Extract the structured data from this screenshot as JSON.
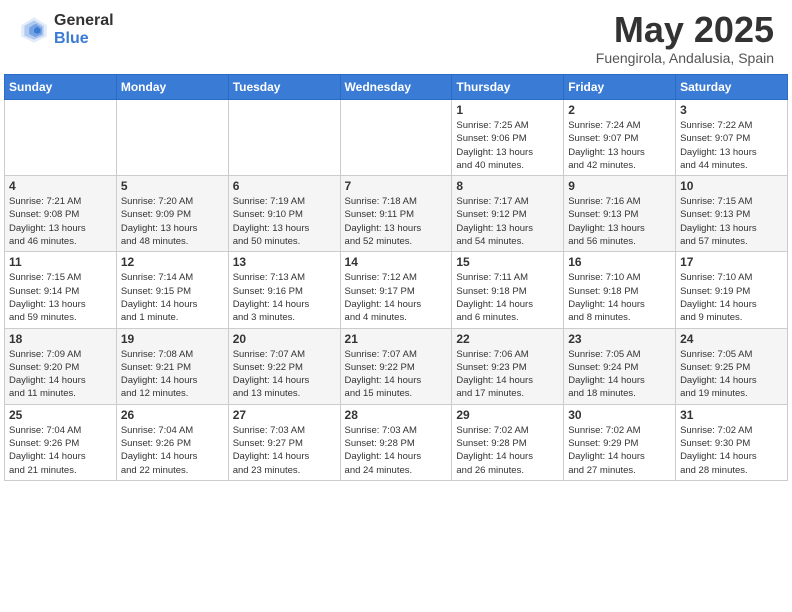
{
  "logo": {
    "general": "General",
    "blue": "Blue"
  },
  "title": "May 2025",
  "location": "Fuengirola, Andalusia, Spain",
  "days_of_week": [
    "Sunday",
    "Monday",
    "Tuesday",
    "Wednesday",
    "Thursday",
    "Friday",
    "Saturday"
  ],
  "weeks": [
    [
      {
        "day": "",
        "info": ""
      },
      {
        "day": "",
        "info": ""
      },
      {
        "day": "",
        "info": ""
      },
      {
        "day": "",
        "info": ""
      },
      {
        "day": "1",
        "info": "Sunrise: 7:25 AM\nSunset: 9:06 PM\nDaylight: 13 hours\nand 40 minutes."
      },
      {
        "day": "2",
        "info": "Sunrise: 7:24 AM\nSunset: 9:07 PM\nDaylight: 13 hours\nand 42 minutes."
      },
      {
        "day": "3",
        "info": "Sunrise: 7:22 AM\nSunset: 9:07 PM\nDaylight: 13 hours\nand 44 minutes."
      }
    ],
    [
      {
        "day": "4",
        "info": "Sunrise: 7:21 AM\nSunset: 9:08 PM\nDaylight: 13 hours\nand 46 minutes."
      },
      {
        "day": "5",
        "info": "Sunrise: 7:20 AM\nSunset: 9:09 PM\nDaylight: 13 hours\nand 48 minutes."
      },
      {
        "day": "6",
        "info": "Sunrise: 7:19 AM\nSunset: 9:10 PM\nDaylight: 13 hours\nand 50 minutes."
      },
      {
        "day": "7",
        "info": "Sunrise: 7:18 AM\nSunset: 9:11 PM\nDaylight: 13 hours\nand 52 minutes."
      },
      {
        "day": "8",
        "info": "Sunrise: 7:17 AM\nSunset: 9:12 PM\nDaylight: 13 hours\nand 54 minutes."
      },
      {
        "day": "9",
        "info": "Sunrise: 7:16 AM\nSunset: 9:13 PM\nDaylight: 13 hours\nand 56 minutes."
      },
      {
        "day": "10",
        "info": "Sunrise: 7:15 AM\nSunset: 9:13 PM\nDaylight: 13 hours\nand 57 minutes."
      }
    ],
    [
      {
        "day": "11",
        "info": "Sunrise: 7:15 AM\nSunset: 9:14 PM\nDaylight: 13 hours\nand 59 minutes."
      },
      {
        "day": "12",
        "info": "Sunrise: 7:14 AM\nSunset: 9:15 PM\nDaylight: 14 hours\nand 1 minute."
      },
      {
        "day": "13",
        "info": "Sunrise: 7:13 AM\nSunset: 9:16 PM\nDaylight: 14 hours\nand 3 minutes."
      },
      {
        "day": "14",
        "info": "Sunrise: 7:12 AM\nSunset: 9:17 PM\nDaylight: 14 hours\nand 4 minutes."
      },
      {
        "day": "15",
        "info": "Sunrise: 7:11 AM\nSunset: 9:18 PM\nDaylight: 14 hours\nand 6 minutes."
      },
      {
        "day": "16",
        "info": "Sunrise: 7:10 AM\nSunset: 9:18 PM\nDaylight: 14 hours\nand 8 minutes."
      },
      {
        "day": "17",
        "info": "Sunrise: 7:10 AM\nSunset: 9:19 PM\nDaylight: 14 hours\nand 9 minutes."
      }
    ],
    [
      {
        "day": "18",
        "info": "Sunrise: 7:09 AM\nSunset: 9:20 PM\nDaylight: 14 hours\nand 11 minutes."
      },
      {
        "day": "19",
        "info": "Sunrise: 7:08 AM\nSunset: 9:21 PM\nDaylight: 14 hours\nand 12 minutes."
      },
      {
        "day": "20",
        "info": "Sunrise: 7:07 AM\nSunset: 9:22 PM\nDaylight: 14 hours\nand 13 minutes."
      },
      {
        "day": "21",
        "info": "Sunrise: 7:07 AM\nSunset: 9:22 PM\nDaylight: 14 hours\nand 15 minutes."
      },
      {
        "day": "22",
        "info": "Sunrise: 7:06 AM\nSunset: 9:23 PM\nDaylight: 14 hours\nand 17 minutes."
      },
      {
        "day": "23",
        "info": "Sunrise: 7:05 AM\nSunset: 9:24 PM\nDaylight: 14 hours\nand 18 minutes."
      },
      {
        "day": "24",
        "info": "Sunrise: 7:05 AM\nSunset: 9:25 PM\nDaylight: 14 hours\nand 19 minutes."
      }
    ],
    [
      {
        "day": "25",
        "info": "Sunrise: 7:04 AM\nSunset: 9:26 PM\nDaylight: 14 hours\nand 21 minutes."
      },
      {
        "day": "26",
        "info": "Sunrise: 7:04 AM\nSunset: 9:26 PM\nDaylight: 14 hours\nand 22 minutes."
      },
      {
        "day": "27",
        "info": "Sunrise: 7:03 AM\nSunset: 9:27 PM\nDaylight: 14 hours\nand 23 minutes."
      },
      {
        "day": "28",
        "info": "Sunrise: 7:03 AM\nSunset: 9:28 PM\nDaylight: 14 hours\nand 24 minutes."
      },
      {
        "day": "29",
        "info": "Sunrise: 7:02 AM\nSunset: 9:28 PM\nDaylight: 14 hours\nand 26 minutes."
      },
      {
        "day": "30",
        "info": "Sunrise: 7:02 AM\nSunset: 9:29 PM\nDaylight: 14 hours\nand 27 minutes."
      },
      {
        "day": "31",
        "info": "Sunrise: 7:02 AM\nSunset: 9:30 PM\nDaylight: 14 hours\nand 28 minutes."
      }
    ]
  ]
}
